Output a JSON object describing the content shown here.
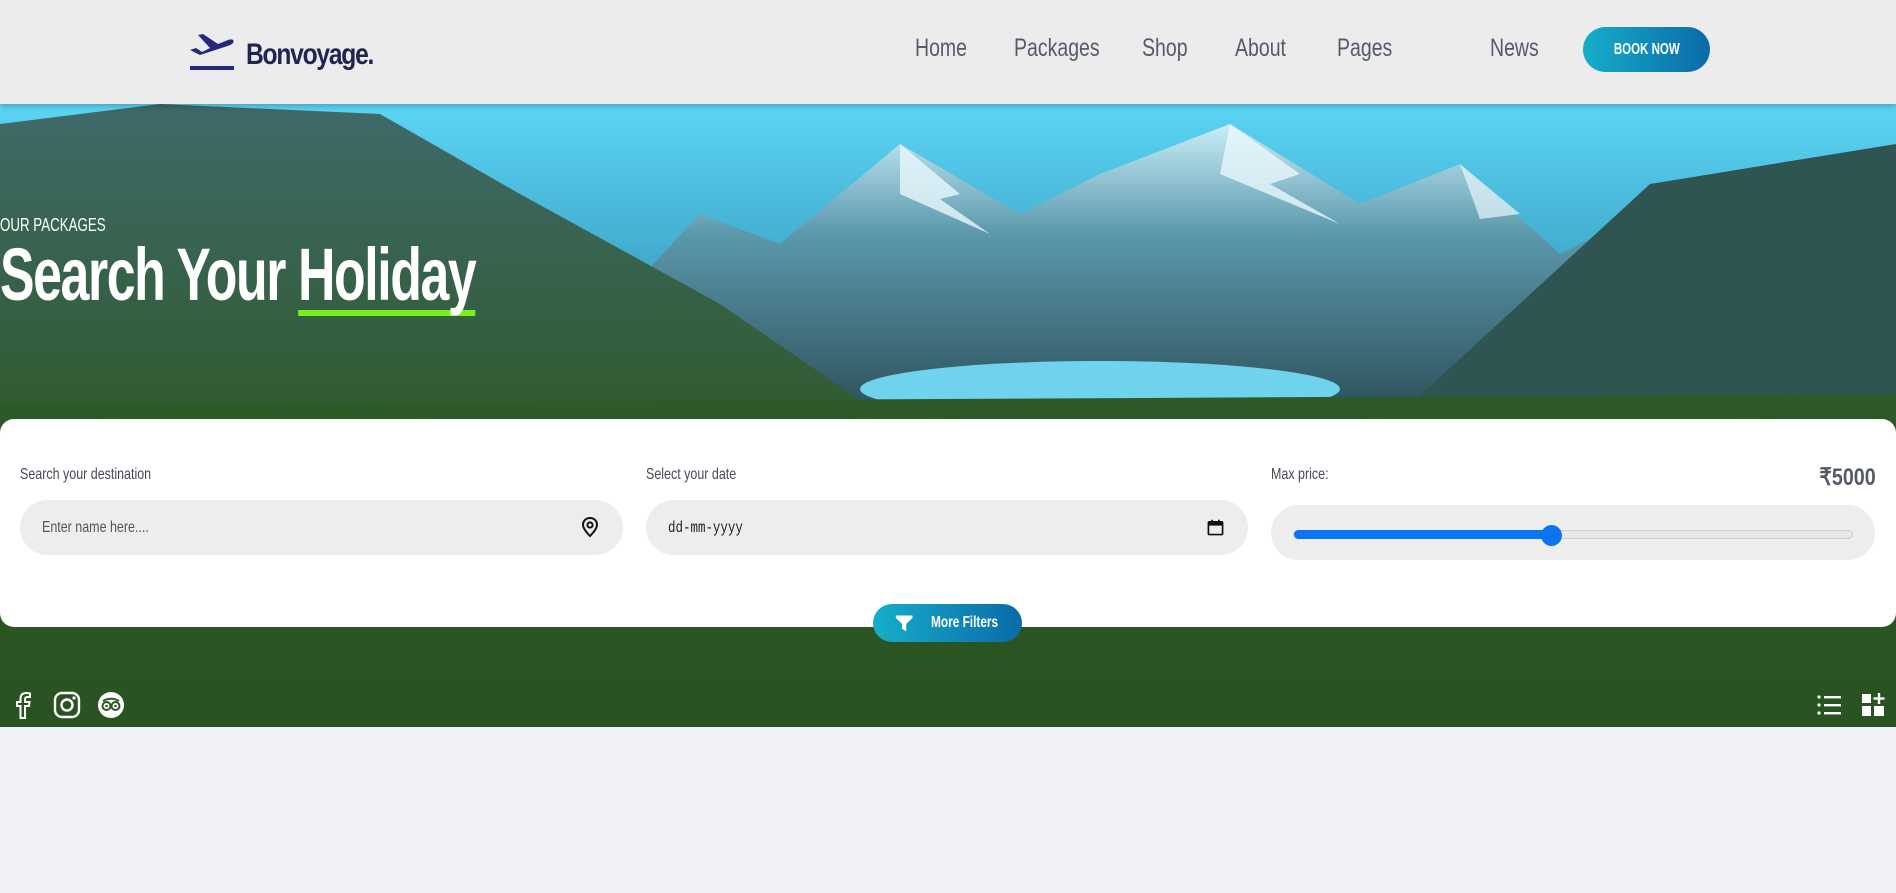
{
  "brand": {
    "name": "Bonvoyage.",
    "logo_icon": "plane-departure-icon",
    "color": "#1d2550"
  },
  "nav": {
    "items": [
      {
        "label": "Home"
      },
      {
        "label": "Packages"
      },
      {
        "label": "Shop"
      },
      {
        "label": "About"
      },
      {
        "label": "Pages"
      },
      {
        "label": "News"
      }
    ],
    "book_label": "BOOK NOW"
  },
  "hero": {
    "subtitle": "OUR PACKAGES",
    "title_prefix": "Search Your",
    "title_highlight": "Holiday",
    "highlight_color": "#79f01b"
  },
  "search": {
    "destination_label": "Search your destination",
    "destination_placeholder": "Enter name here....",
    "date_label": "Select your date",
    "date_placeholder": "dd-mm-yyyy",
    "price_label": "Max price:",
    "price_value": "₹5000",
    "price_slider_fraction": 0.46,
    "more_filters_label": "More Filters"
  },
  "social": [
    "facebook-icon",
    "instagram-icon",
    "tripadvisor-icon"
  ],
  "view_toggles": [
    "list-view-icon",
    "grid-view-icon"
  ],
  "colors": {
    "accent_start": "#16aec9",
    "accent_end": "#0a6aa8",
    "slider": "#0b74ef"
  }
}
